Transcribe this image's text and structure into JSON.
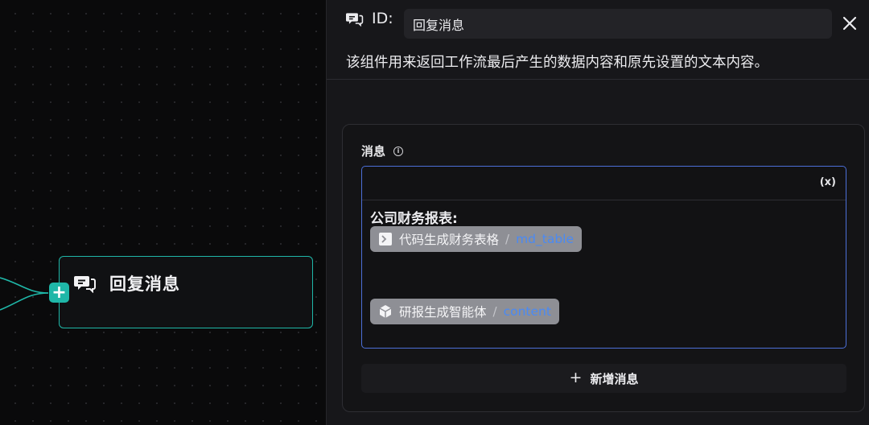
{
  "canvas": {
    "node": {
      "title": "回复消息",
      "icon": "reply-message-icon",
      "add_symbol": "+"
    }
  },
  "panel": {
    "id_label": "ID:",
    "id_value": "回复消息",
    "description": "该组件用来返回工作流最后产生的数据内容和原先设置的文本内容。",
    "message_label": "消息",
    "editor": {
      "variable_button": "(x)",
      "heading": "公司财务报表:",
      "chips": [
        {
          "name": "代码生成财务表格",
          "separator": "/",
          "variable": "md_table",
          "icon": "terminal-icon"
        },
        {
          "name": "研报生成智能体",
          "separator": "/",
          "variable": "content",
          "icon": "cube-icon"
        }
      ]
    },
    "add_message_label": "新增消息",
    "add_message_symbol": "+"
  },
  "colors": {
    "accent": "#1fb7a8",
    "editor_border": "#4c6fd8",
    "variable_text": "#4a8af4",
    "chip_bg": "#8e8f95"
  }
}
